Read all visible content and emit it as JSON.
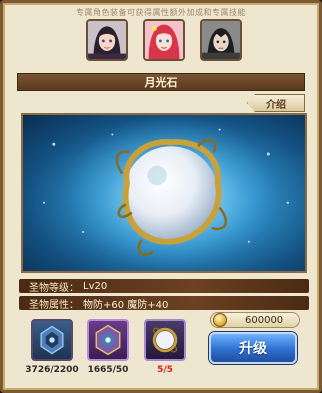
{
  "header": {
    "hint": "专属角色装备可获得属性额外加成和专属技能",
    "portraits": [
      "dark-haired-heroine-portrait",
      "red-haired-heroine-portrait",
      "dark-armored-hero-portrait"
    ]
  },
  "equipment": {
    "name": "月光石",
    "intro_label": "介绍",
    "art": "moonstone-orb-in-gold-vine-frame"
  },
  "stats": {
    "level_label": "圣物等级：",
    "level_value": "Lv20",
    "attr_label": "圣物属性：",
    "attr_value": "物防+60 魔防+40"
  },
  "materials": [
    {
      "icon": "blue-crest-material-icon",
      "count": "3726/2200",
      "sufficient": true
    },
    {
      "icon": "purple-crest-material-icon",
      "count": "1665/50",
      "sufficient": true
    },
    {
      "icon": "moonstone-material-icon",
      "count": "5/5",
      "sufficient": false
    }
  ],
  "upgrade": {
    "cost": "600000",
    "button_label": "升级"
  },
  "colors": {
    "title_bar": "#6b4122",
    "button_blue": "#2f6fd0",
    "insufficient": "#d02020"
  }
}
